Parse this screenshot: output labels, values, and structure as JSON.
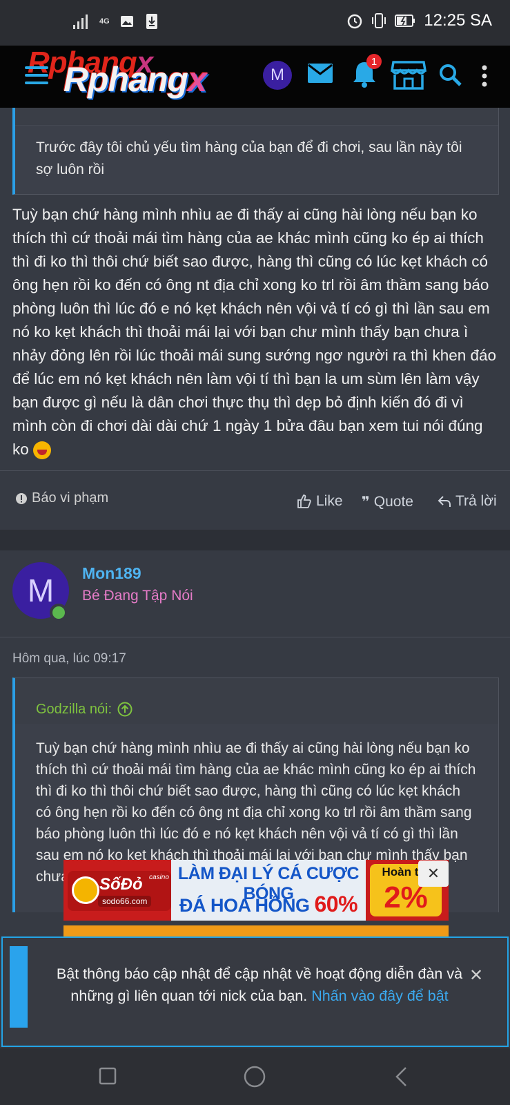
{
  "status_bar": {
    "network": "4G",
    "time": "12:25 SA"
  },
  "header": {
    "logo_text": "Rphangx",
    "avatar_initial": "M",
    "notification_count": "1"
  },
  "quote_top": {
    "text": "Trước đây tôi chủ yếu tìm hàng của bạn để đi chơi, sau lần này tôi sợ luôn rồi"
  },
  "post_body": {
    "text": "Tuỳ bạn chứ hàng mình nhìu ae đi thấy ai cũng hài lòng nếu bạn ko thích thì cứ thoải mái tìm hàng của ae khác mình cũng ko ép ai thích thì đi ko thì thôi chứ biết sao được, hàng thì cũng có lúc kẹt khách có ông hẹn rồi ko đến có ông nt địa chỉ xong ko trl rồi âm thầm sang báo phòng luôn thì lúc đó e nó kẹt khách nên vội vả tí có gì thì lần sau em nó ko kẹt khách thì thoải mái lại với bạn chư mình thấy bạn chưa ì nhảy đỏng lên rồi lúc thoải mái sung sướng ngơ người ra thì khen đáo để lúc em nó kẹt khách nên làm vội tí thì bạn la um sùm lên làm vậy bạn được gì nếu là dân chơi thực thụ thì dẹp bỏ định kiến đó đi vì mình còn đi chơi dài dài chứ 1 ngày 1 bửa đâu bạn xem tui nói đúng ko"
  },
  "actions": {
    "report": "Báo vi phạm",
    "like": "Like",
    "quote": "Quote",
    "reply": "Trả lời"
  },
  "post2": {
    "avatar_initial": "M",
    "username": "Mon189",
    "user_title": "Bé Đang Tập Nói",
    "timestamp": "Hôm qua, lúc 09:17",
    "quote_author": "Godzilla nói:",
    "quote_text": "Tuỳ bạn chứ hàng mình nhìu ae đi thấy ai cũng hài lòng nếu bạn ko thích thì cứ thoải mái tìm hàng của ae khác mình cũng ko ép ai thích thì đi ko thì thôi chứ biết sao được, hàng thì cũng có lúc kẹt khách có ông hẹn rồi ko đến có ông nt địa chỉ xong ko trl rồi âm thầm sang báo phòng luôn thì lúc đó e nó kẹt khách nên vội vả tí có gì thì lần sau em nó ko kẹt khách thì thoải mái lại với bạn chư mình thấy bạn chưa ì nhảy đỏng lên rồi lúc thoải mái"
  },
  "ad": {
    "brand": "SốĐỏ",
    "brand_tag": "casino",
    "domain": "sodo66.com",
    "line1": "LÀM ĐẠI LÝ CÁ CƯỢC BÓNG",
    "line2_prefix": "ĐÁ HOA HỒNG",
    "line2_pct": "60%",
    "badge_top": "Hoàn trả",
    "badge_pct": "2%"
  },
  "notice": {
    "text": "Bật thông báo cập nhật để cập nhật về hoạt động diễn đàn và những gì liên quan tới nick của bạn.",
    "link": "Nhấn vào đây để bật"
  },
  "colors": {
    "accent": "#2b9fe6",
    "background": "#363a43",
    "username": "#4fb3f0",
    "user_title": "#e67cc8",
    "quote_author": "#7fc33f"
  }
}
